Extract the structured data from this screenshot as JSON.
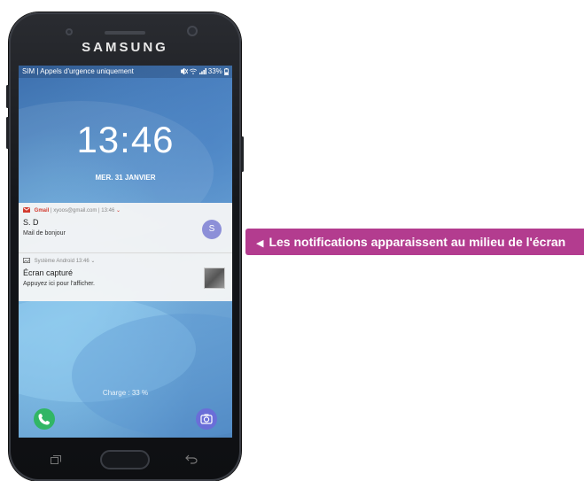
{
  "phone": {
    "brand": "SAMSUNG",
    "status_left": "SIM | Appels d'urgence uniquement",
    "status_right": "33%",
    "time": "13:46",
    "date": "MER. 31 JANVIER",
    "charge": "Charge : 33 %"
  },
  "notifications": [
    {
      "app": "Gmail",
      "account": "xyoos@gmail.com",
      "time": "13:46",
      "title": "S. D",
      "text": "Mail de bonjour",
      "avatar_letter": "S",
      "icon": "gmail-icon"
    },
    {
      "app": "Système Android",
      "time": "13:46",
      "title": "Écran capturé",
      "text": "Appuyez ici pour l'afficher.",
      "icon": "screenshot-icon"
    }
  ],
  "callout": {
    "text": "Les notifications apparaissent au milieu de l'écran"
  },
  "colors": {
    "callout": "#b33c8f",
    "call_button": "#31b665",
    "camera_button": "#6a6ed8",
    "gmail_red": "#d23b2f",
    "avatar": "#8c8fd8"
  }
}
